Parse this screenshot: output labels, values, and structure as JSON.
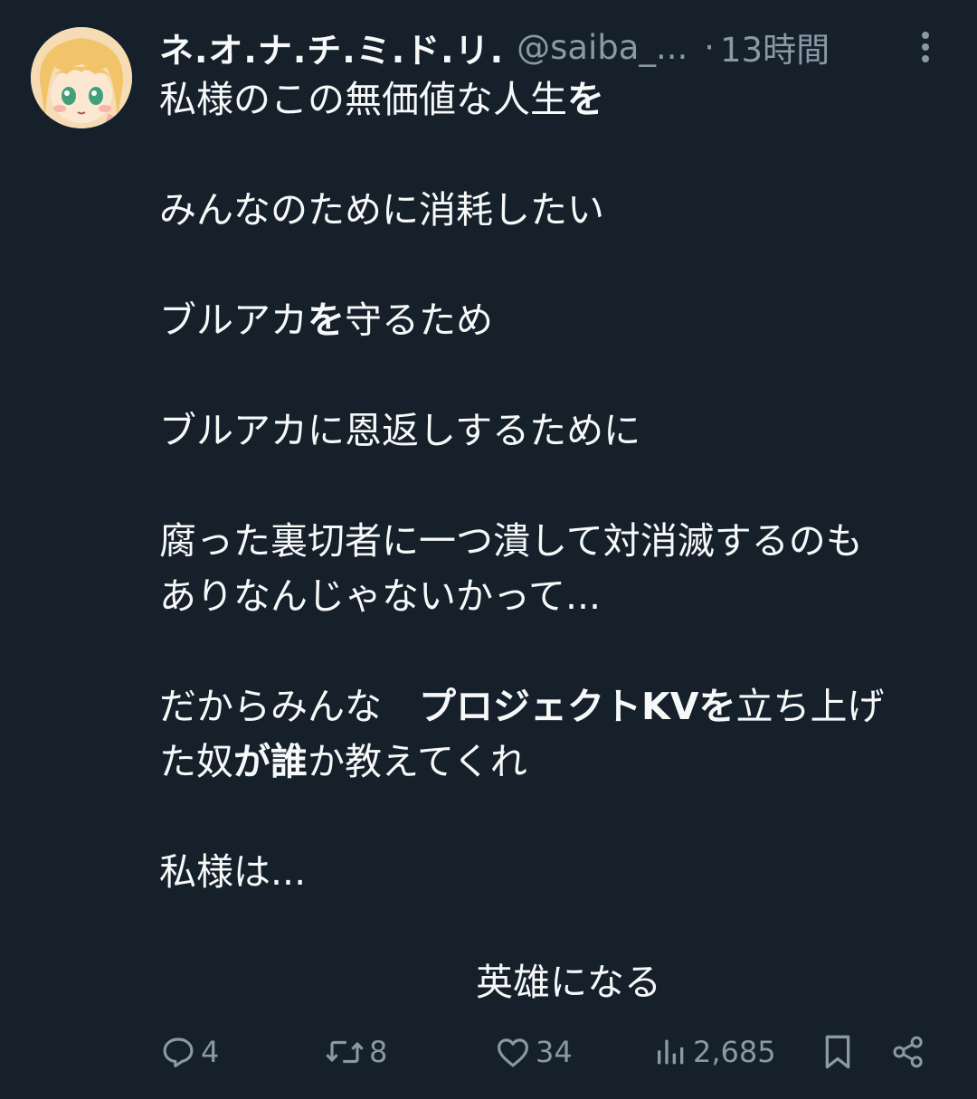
{
  "author": {
    "display_name": "ネ.オ.ナ.チ.ミ.ド.リ.",
    "handle": "@saiba_...",
    "separator": "·",
    "time": "13時間"
  },
  "icons": {
    "more": "more-vertical-icon",
    "reply": "reply-icon",
    "repost": "repost-icon",
    "like": "heart-icon",
    "views": "views-icon",
    "bookmark": "bookmark-icon",
    "share": "share-icon"
  },
  "post": {
    "l1_a": "私様のこの無価値な人生",
    "l1_b": "を",
    "l2": "みんなのために消耗したい",
    "l3_a": "ブルアカ",
    "l3_b": "を",
    "l3_c": "守るため",
    "l4": "ブルアカに恩返しするために",
    "l5": "腐った裏切者に一つ潰して対消滅するのも",
    "l6": "ありなんじゃないかって...",
    "l7_a": "だからみんな　",
    "l7_b": "プロジェクトKVを",
    "l7_c": "立ち上げ",
    "l8_a": "た奴",
    "l8_b": "が誰",
    "l8_c": "か教えてくれ",
    "l9": "私様は...",
    "l10": "英雄になる"
  },
  "stats": {
    "replies": "4",
    "reposts": "8",
    "likes": "34",
    "views": "2,685"
  },
  "colors": {
    "background": "#15202b",
    "text": "#f7f9f9",
    "secondary": "#8b98a5"
  }
}
